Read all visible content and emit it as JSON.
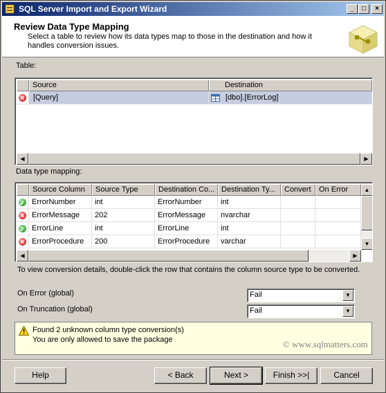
{
  "window": {
    "title": "SQL Server Import and Export Wizard"
  },
  "header": {
    "title": "Review Data Type Mapping",
    "description": "Select a table to review how its data types map to those in the destination and how it handles conversion issues."
  },
  "table_section": {
    "label": "Table:",
    "columns": [
      "Source",
      "Destination"
    ],
    "rows": [
      {
        "status": "error",
        "source": "[Query]",
        "destination": "[dbo].[ErrorLog]"
      }
    ]
  },
  "mapping_section": {
    "label": "Data type mapping:",
    "columns": [
      "Source Column",
      "Source Type",
      "Destination Co...",
      "Destination Ty...",
      "Convert",
      "On Error"
    ],
    "rows": [
      {
        "status": "ok",
        "source_column": "ErrorNumber",
        "source_type": "int",
        "dest_column": "ErrorNumber",
        "dest_type": "int"
      },
      {
        "status": "error",
        "source_column": "ErrorMessage",
        "source_type": "202",
        "dest_column": "ErrorMessage",
        "dest_type": "nvarchar"
      },
      {
        "status": "ok",
        "source_column": "ErrorLine",
        "source_type": "int",
        "dest_column": "ErrorLine",
        "dest_type": "int"
      },
      {
        "status": "error",
        "source_column": "ErrorProcedure",
        "source_type": "200",
        "dest_column": "ErrorProcedure",
        "dest_type": "varchar"
      }
    ]
  },
  "hint": "To view conversion details, double-click the row that contains the column source type to be converted.",
  "on_error": {
    "label": "On Error (global)",
    "value": "Fail"
  },
  "on_truncation": {
    "label": "On Truncation (global)",
    "value": "Fail"
  },
  "info": {
    "line1": "Found 2 unknown column type conversion(s)",
    "line2": "You are only allowed to save the package"
  },
  "watermark": "© www.sqlmatters.com",
  "buttons": {
    "help": "Help",
    "back": "< Back",
    "next": "Next >",
    "finish": "Finish >>|",
    "cancel": "Cancel"
  }
}
